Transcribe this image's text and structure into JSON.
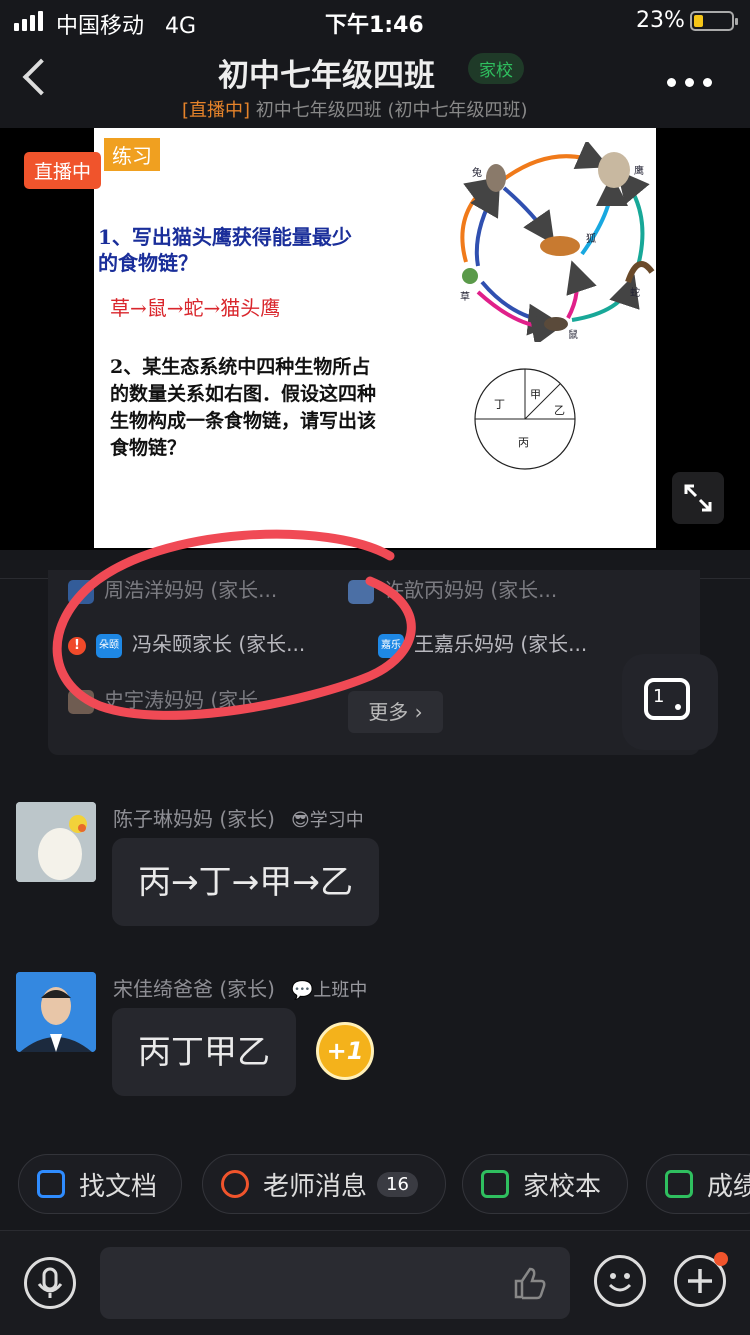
{
  "status_bar": {
    "carrier": "中国移动",
    "network": "4G",
    "time": "下午1:46",
    "battery": "23%"
  },
  "header": {
    "title": "初中七年级四班",
    "tag": "家校",
    "live_prefix": "[直播中]",
    "subtitle": "初中七年级四班 (初中七年级四班)"
  },
  "video": {
    "live_badge": "直播中",
    "slide": {
      "heading": "练习",
      "q1": "1、写出猫头鹰获得能量最少的食物链？",
      "answer": "草→鼠→蛇→猫头鹰",
      "q2": "2、某生态系统中四种生物所占的数量关系如右图．假设这四种生物构成一条食物链，请写出该食物链？",
      "food_web_labels": [
        "兔",
        "鹰",
        "狐",
        "草",
        "蛇",
        "鼠"
      ],
      "pie_labels": [
        "丁",
        "甲",
        "乙",
        "丙"
      ]
    }
  },
  "viewer_list": {
    "rows": [
      [
        "周浩洋妈妈 (家长...",
        "许歆丙妈妈 (家长..."
      ],
      [
        "冯朵颐家长 (家长...",
        "王嘉乐妈妈 (家长..."
      ],
      [
        "史宇涛妈妈 (家长..."
      ]
    ],
    "icon_text_1": "朵颐",
    "icon_text_2": "嘉乐",
    "more_label": "更多 ›",
    "float_label": "1"
  },
  "messages": [
    {
      "name": "陈子琳妈妈 (家长)",
      "status": "学习中",
      "text": "丙→丁→甲→乙"
    },
    {
      "name": "宋佳绮爸爸 (家长)",
      "status": "上班中",
      "text": "丙丁甲乙",
      "reaction": "+1"
    }
  ],
  "quick_actions": [
    {
      "label": "找文档",
      "icon": "doc-search-icon",
      "color": "#2f8cff"
    },
    {
      "label": "老师消息",
      "icon": "teacher-icon",
      "color": "#f0542c",
      "count": "16"
    },
    {
      "label": "家校本",
      "icon": "notebook-icon",
      "color": "#2fbf5f"
    },
    {
      "label": "成绩",
      "icon": "score-icon",
      "color": "#2fbf5f"
    }
  ],
  "input_bar": {
    "mic": "microphone-icon",
    "like": "thumbs-up-icon",
    "emoji": "emoji-icon",
    "add": "plus-icon"
  }
}
